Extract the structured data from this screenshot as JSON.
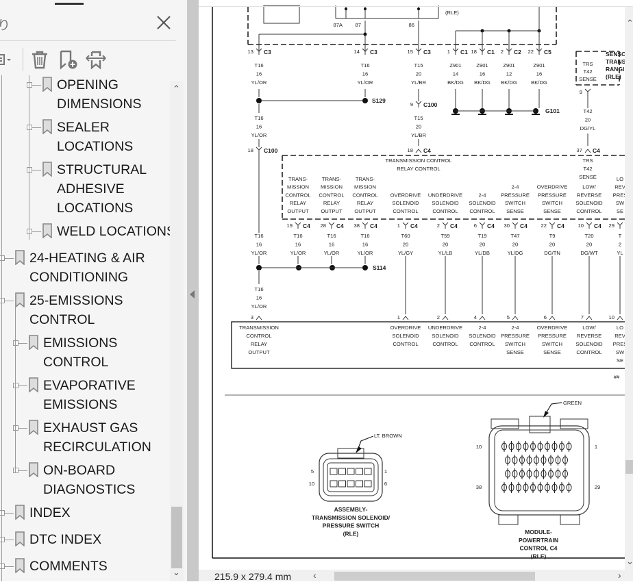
{
  "sidebar": {
    "title": "り",
    "close_icon": "close-icon",
    "toolbar": [
      "options-menu-icon",
      "delete-bookmark-icon",
      "add-bookmark-icon",
      "expand-bookmark-icon"
    ],
    "bookmarks": [
      {
        "level": 3,
        "lines": [
          "OPENING",
          "DIMENSIONS"
        ]
      },
      {
        "level": 3,
        "lines": [
          "SEALER",
          "LOCATIONS"
        ]
      },
      {
        "level": 3,
        "lines": [
          "STRUCTURAL",
          "ADHESIVE",
          "LOCATIONS"
        ]
      },
      {
        "level": 3,
        "lines": [
          "WELD LOCATIONS"
        ]
      },
      {
        "level": 1,
        "lines": [
          "24-HEATING & AIR",
          "CONDITIONING"
        ]
      },
      {
        "level": 1,
        "lines": [
          "25-EMISSIONS",
          "CONTROL"
        ]
      },
      {
        "level": 2,
        "lines": [
          "EMISSIONS",
          "CONTROL"
        ]
      },
      {
        "level": 2,
        "lines": [
          "EVAPORATIVE",
          "EMISSIONS"
        ]
      },
      {
        "level": 2,
        "lines": [
          "EXHAUST GAS",
          "RECIRCULATION"
        ]
      },
      {
        "level": 2,
        "lines": [
          "ON-BOARD",
          "DIAGNOSTICS"
        ]
      },
      {
        "level": 1,
        "lines": [
          "INDEX"
        ]
      },
      {
        "level": 1,
        "lines": [
          "DTC INDEX"
        ]
      },
      {
        "level": 1,
        "lines": [
          "COMMENTS"
        ]
      }
    ]
  },
  "status": {
    "page_size": "215.9 x 279.4 mm"
  },
  "diagram": {
    "top_partial": {
      "pins": [
        "87A",
        "87",
        "86"
      ],
      "rle": "(RLE)"
    },
    "top_connectors": [
      {
        "pin": "13",
        "conn": "C3",
        "wire": [
          "T16",
          "16",
          "YL/OR"
        ]
      },
      {
        "pin": "14",
        "conn": "C3",
        "wire": [
          "T16",
          "16",
          "YL/OR"
        ]
      },
      {
        "pin": "15",
        "conn": "C3",
        "wire": [
          "T15",
          "20",
          "YL/BR"
        ]
      },
      {
        "pin": "1",
        "conn": "C1",
        "wire": [
          "Z901",
          "14",
          "BK/DG"
        ]
      },
      {
        "pin": "18",
        "conn": "C1",
        "wire": [
          "Z901",
          "16",
          "BK/DG"
        ]
      },
      {
        "pin": "2",
        "conn": "C2",
        "wire": [
          "Z901",
          "12",
          "BK/DG"
        ]
      },
      {
        "pin": "22",
        "conn": "C5",
        "wire": [
          "Z901",
          "16",
          "BK/DG"
        ]
      }
    ],
    "splices": {
      "s129": "S129",
      "s114": "S114",
      "g101": "G101"
    },
    "c100": [
      {
        "pin": "9",
        "conn": "C100"
      },
      {
        "pin": "18",
        "conn": "C100"
      }
    ],
    "mid_wires": [
      {
        "x": "left",
        "wire": [
          "T16",
          "16",
          "YL/OR"
        ]
      },
      {
        "x": "t15",
        "wire": [
          "T15",
          "20",
          "YL/BR"
        ]
      },
      {
        "x": "t42",
        "wire": [
          "T42",
          "20",
          "DG/YL"
        ]
      }
    ],
    "c4_top": [
      {
        "pin": "18",
        "conn": "C4"
      },
      {
        "pin": "37",
        "conn": "C4"
      }
    ],
    "sensor": {
      "box": [
        "TRS",
        "T42",
        "SENSE"
      ],
      "pin": "9",
      "title": [
        "SENSO",
        "TRANS",
        "RANGI",
        "(RLE)"
      ]
    },
    "pcm_header": [
      "TRANSMISSION CONTROL",
      "RELAY CONTROL"
    ],
    "pcm_trs": [
      "TRS",
      "T42",
      "SENSE"
    ],
    "pcm_columns": [
      {
        "label": [
          "TRANS-",
          "MISSION",
          "CONTROL",
          "RELAY",
          "OUTPUT"
        ],
        "pin": "19",
        "conn": "C4",
        "wire": [
          "T16",
          "16",
          "YL/OR"
        ]
      },
      {
        "label": [
          "TRANS-",
          "MISSION",
          "CONTROL",
          "RELAY",
          "OUTPUT"
        ],
        "pin": "28",
        "conn": "C4",
        "wire": [
          "T16",
          "16",
          "YL/OR"
        ]
      },
      {
        "label": [
          "TRANS-",
          "MISSION",
          "CONTROL",
          "RELAY",
          "OUTPUT"
        ],
        "pin": "38",
        "conn": "C4",
        "wire": [
          "T16",
          "16",
          "YL/OR"
        ]
      },
      {
        "label": [
          "OVERDRIVE",
          "SOLENOID",
          "CONTROL"
        ],
        "pin": "1",
        "conn": "C4",
        "wire": [
          "T60",
          "20",
          "YL/GY"
        ],
        "bpin": "1",
        "blabel": [
          "OVERDRIVE",
          "SOLENOID",
          "CONTROL"
        ]
      },
      {
        "label": [
          "UNDERDRIVE",
          "SOLENOID",
          "CONTROL"
        ],
        "pin": "2",
        "conn": "C4",
        "wire": [
          "T59",
          "20",
          "YL/LB"
        ],
        "bpin": "2",
        "blabel": [
          "UNDERDRIVE",
          "SOLENOID",
          "CONTROL"
        ]
      },
      {
        "label": [
          "2-4",
          "SOLENOID",
          "CONTROL"
        ],
        "pin": "6",
        "conn": "C4",
        "wire": [
          "T19",
          "20",
          "YL/DB"
        ],
        "bpin": "4",
        "blabel": [
          "2-4",
          "SOLENOID",
          "CONTROL"
        ]
      },
      {
        "label": [
          "2-4",
          "PRESSURE",
          "SWITCH",
          "SENSE"
        ],
        "pin": "30",
        "conn": "C4",
        "wire": [
          "T47",
          "20",
          "YL/DG"
        ],
        "bpin": "5",
        "blabel": [
          "2-4",
          "PRESSURE",
          "SWITCH",
          "SENSE"
        ]
      },
      {
        "label": [
          "OVERDRIVE",
          "PRESSURE",
          "SWITCH",
          "SENSE"
        ],
        "pin": "22",
        "conn": "C4",
        "wire": [
          "T9",
          "20",
          "DG/TN"
        ],
        "bpin": "6",
        "blabel": [
          "OVERDRIVE",
          "PRESSURE",
          "SWITCH",
          "SENSE"
        ]
      },
      {
        "label": [
          "LOW/",
          "REVERSE",
          "SOLENOID",
          "CONTROL"
        ],
        "pin": "10",
        "conn": "C4",
        "wire": [
          "T20",
          "20",
          "DG/WT"
        ],
        "bpin": "7",
        "blabel": [
          "LOW/",
          "REVERSE",
          "SOLENOID",
          "CONTROL"
        ]
      },
      {
        "label": [
          "LO",
          "REV",
          "PRES",
          "SW",
          "SE"
        ],
        "pin": "29",
        "conn": "",
        "wire": [
          "T",
          "2",
          "YL"
        ],
        "bpin": "10",
        "blabel": [
          "LO",
          "REV",
          "PRES",
          "SW",
          "SE"
        ]
      }
    ],
    "left_bottom_wire": [
      "T16",
      "16",
      "YL/OR"
    ],
    "left_bottom_pin": "3",
    "bottom_left_label": [
      "TRANSMISSION",
      "CONTROL",
      "RELAY",
      "OUTPUT"
    ],
    "page_mark": "##",
    "conn_a": {
      "color": "LT. BROWN",
      "pins": [
        "5",
        "10",
        "1",
        "6"
      ],
      "title": [
        "ASSEMBLY-",
        "TRANSMISSION SOLENOID/",
        "PRESSURE SWITCH",
        "(RLE)"
      ]
    },
    "conn_b": {
      "color": "GREEN",
      "pins": [
        "10",
        "38",
        "1",
        "29"
      ],
      "title": [
        "MODULE-",
        "POWERTRAIN",
        "CONTROL C4",
        "(RLE)"
      ]
    }
  }
}
